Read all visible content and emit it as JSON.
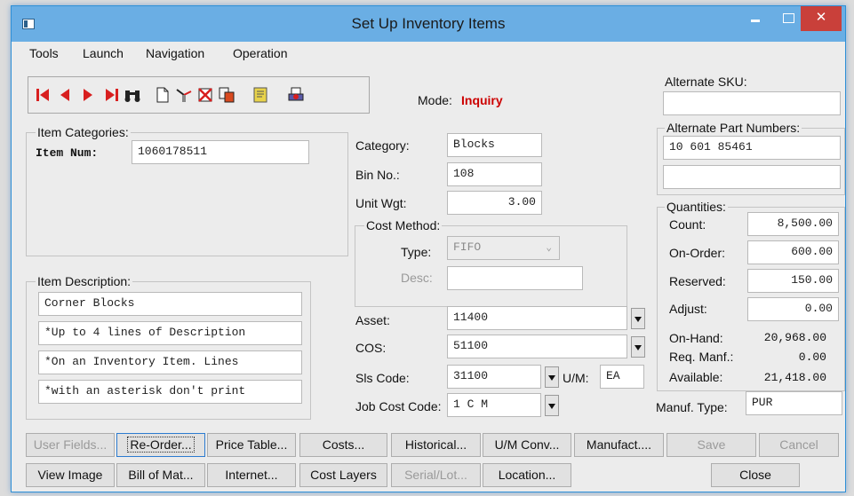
{
  "window": {
    "title": "Set Up Inventory Items",
    "minimize": "",
    "maximize": "",
    "close": "✕"
  },
  "menu": [
    "Tools",
    "Launch",
    "Navigation",
    "Operation"
  ],
  "toolbar": {
    "icons": [
      "first-record-icon",
      "previous-record-icon",
      "next-record-icon",
      "last-record-icon",
      "find-binoculars-icon",
      "new-document-icon",
      "clear-icon",
      "delete-icon",
      "copy-icon",
      "notes-icon",
      "print-icon"
    ],
    "colors": {
      "nav": "#d81f1f"
    }
  },
  "mode": {
    "label": "Mode:",
    "value": "Inquiry"
  },
  "item_categories": {
    "label": "Item Categories:",
    "item_num_label": "Item Num:",
    "item_num": "1060178511"
  },
  "category": {
    "label": "Category:",
    "value": "Blocks"
  },
  "bin": {
    "label": "Bin No.:",
    "value": "108"
  },
  "unit_wgt": {
    "label": "Unit Wgt:",
    "value": "3.00"
  },
  "cost_method": {
    "label": "Cost Method:",
    "type_label": "Type:",
    "type_value": "FIFO",
    "desc_label": "Desc:",
    "desc_value": ""
  },
  "asset": {
    "label": "Asset:",
    "value": "11400"
  },
  "cos": {
    "label": "COS:",
    "value": "51100"
  },
  "sls_code": {
    "label": "Sls Code:",
    "value": "31100",
    "um_label": "U/M:",
    "um_value": "EA"
  },
  "job_cost": {
    "label": "Job Cost Code:",
    "value": "1 C M"
  },
  "item_description": {
    "label": "Item Description:",
    "lines": [
      "Corner Blocks",
      "*Up to 4 lines of Description",
      "*On an Inventory Item.  Lines",
      "*with an asterisk don't print"
    ]
  },
  "alternate_sku": {
    "label": "Alternate SKU:",
    "value": ""
  },
  "alternate_parts": {
    "label": "Alternate Part Numbers:",
    "values": [
      "10   601 85461",
      ""
    ]
  },
  "quantities": {
    "label": "Quantities:",
    "rows": [
      {
        "label": "Count:",
        "value": "8,500.00"
      },
      {
        "label": "On-Order:",
        "value": "600.00"
      },
      {
        "label": "Reserved:",
        "value": "150.00"
      },
      {
        "label": "Adjust:",
        "value": "0.00"
      }
    ],
    "static_rows": [
      {
        "label": "On-Hand:",
        "value": "20,968.00"
      },
      {
        "label": "Req. Manf.:",
        "value": "0.00"
      },
      {
        "label": "Available:",
        "value": "21,418.00"
      }
    ]
  },
  "manuf_type": {
    "label": "Manuf. Type:",
    "value": "PUR"
  },
  "buttons_row1": [
    "User Fields...",
    "Re-Order...",
    "Price Table...",
    "Costs...",
    "Historical...",
    "U/M Conv...",
    "Manufact....",
    "Save",
    "Cancel"
  ],
  "buttons_row2": [
    "View Image",
    "Bill of Mat...",
    "Internet...",
    "Cost Layers",
    "Serial/Lot...",
    "Location...",
    "Close"
  ]
}
